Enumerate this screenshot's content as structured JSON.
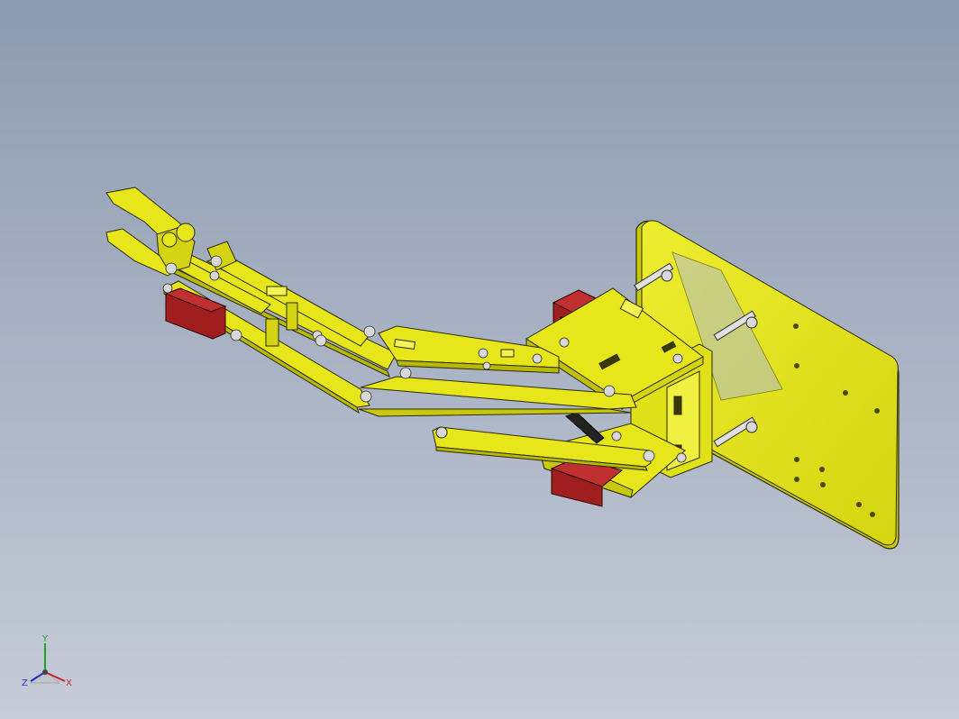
{
  "viewport": {
    "background_top": "#8d9bb0",
    "background_bottom": "#c6ccd8"
  },
  "model": {
    "part_color": "#e6e61a",
    "edge_color": "#2a2a00",
    "servo_color": "#a01e1e",
    "fastener_color": "#d8d8d8"
  },
  "triad": {
    "x_label": "X",
    "y_label": "Y",
    "z_label": "Z",
    "x_color": "#d02020",
    "y_color": "#20a020",
    "z_color": "#2030c0"
  }
}
